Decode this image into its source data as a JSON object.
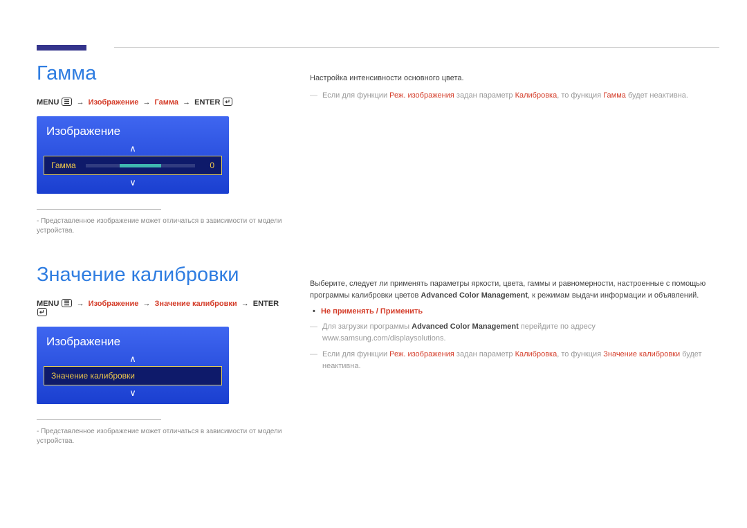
{
  "section1": {
    "title": "Гамма",
    "breadcrumb": {
      "menu": "MENU",
      "path": [
        "Изображение",
        "Гамма"
      ],
      "enter": "ENTER"
    },
    "osd": {
      "title": "Изображение",
      "row_label": "Гамма",
      "row_value": "0"
    },
    "footnote": "Представленное изображение может отличаться в зависимости от модели устройства.",
    "desc": "Настройка интенсивности основного цвета.",
    "note_prefix": "Если для функции ",
    "note_mode": "Реж. изображения",
    "note_mid": " задан параметр ",
    "note_param": "Калибровка",
    "note_mid2": ", то функция ",
    "note_func": "Гамма",
    "note_suffix": " будет неактивна."
  },
  "section2": {
    "title": "Значение калибровки",
    "breadcrumb": {
      "menu": "MENU",
      "path": [
        "Изображение",
        "Значение калибровки"
      ],
      "enter": "ENTER"
    },
    "osd": {
      "title": "Изображение",
      "row_label": "Значение калибровки"
    },
    "footnote": "Представленное изображение может отличаться в зависимости от модели устройства.",
    "desc_line1": "Выберите, следует ли применять параметры яркости, цвета, гаммы и равномерности, настроенные с помощью программы калибровки цветов ",
    "desc_acm": "Advanced Color Management",
    "desc_line2": ", к режимам выдачи информации и объявлений.",
    "bullet_text": "Не применять / Применить",
    "dl_prefix": "Для загрузки программы ",
    "dl_acm": "Advanced Color Management",
    "dl_mid": " перейдите по адресу www.samsung.com/displaysolutions.",
    "note2_prefix": "Если для функции ",
    "note2_mode": "Реж. изображения",
    "note2_mid": " задан параметр ",
    "note2_param": "Калибровка",
    "note2_mid2": ", то функция ",
    "note2_func": "Значение калибровки",
    "note2_suffix": " будет неактивна."
  }
}
